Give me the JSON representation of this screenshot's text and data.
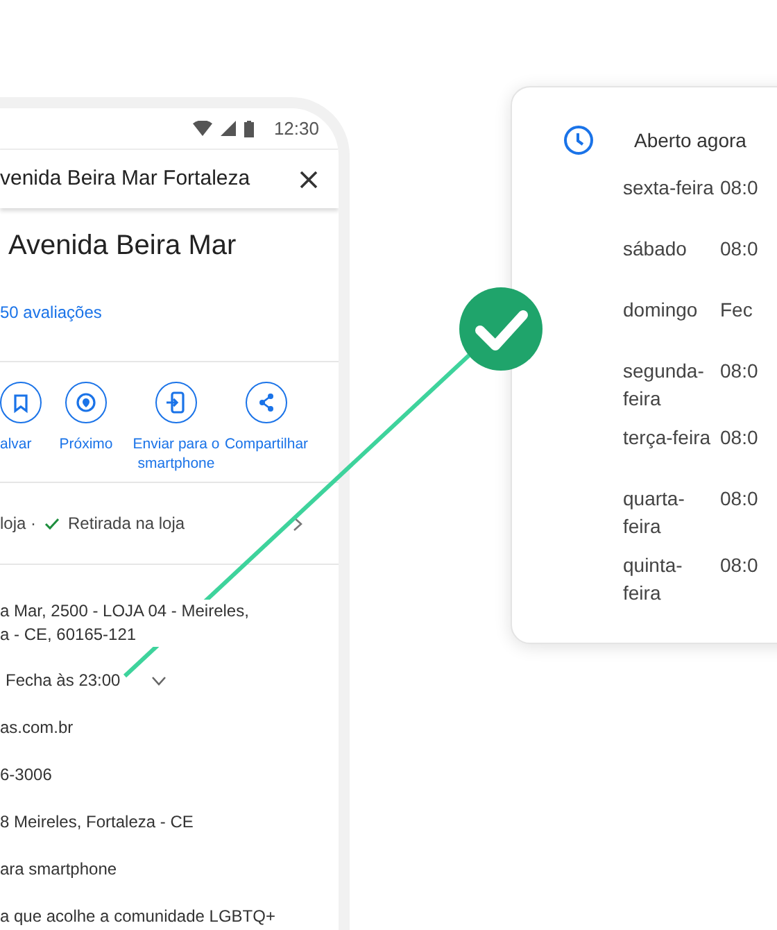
{
  "phone": {
    "status_bar": {
      "time": "12:30"
    },
    "search_bar": {
      "text": "venida Beira Mar Fortaleza"
    },
    "place": {
      "title": "Avenida Beira Mar",
      "reviews": "50 avaliações"
    },
    "actions": [
      {
        "kind": "bookmark",
        "label": "alvar"
      },
      {
        "kind": "nearby",
        "label": "Próximo"
      },
      {
        "kind": "send",
        "label": "Enviar para o smartphone"
      },
      {
        "kind": "share",
        "label": "Compartilhar"
      }
    ],
    "services": {
      "prefix": "loja ·",
      "label": "Retirada na loja"
    },
    "info_rows": [
      {
        "kind": "address",
        "lines": [
          "a Mar, 2500 - LOJA 04 - Meireles,",
          "a - CE, 60165-121"
        ]
      },
      {
        "kind": "hours",
        "lines": [
          "Fecha às 23:00"
        ],
        "expanded": false
      },
      {
        "kind": "plain",
        "lines": [
          "as.com.br"
        ]
      },
      {
        "kind": "plain",
        "lines": [
          "6-3006"
        ]
      },
      {
        "kind": "plain",
        "lines": [
          "8 Meireles, Fortaleza - CE"
        ]
      },
      {
        "kind": "plain",
        "lines": [
          "ara smartphone"
        ]
      },
      {
        "kind": "plain",
        "lines": [
          "a que acolhe a comunidade LGBTQ+"
        ]
      }
    ]
  },
  "hours_card": {
    "status": "Aberto agora",
    "days": [
      {
        "day": "sexta-feira",
        "hours": "08:0"
      },
      {
        "day": "sábado",
        "hours": "08:0"
      },
      {
        "day": "domingo",
        "hours": "Fec"
      },
      {
        "day": "segunda-feira",
        "hours": "08:0"
      },
      {
        "day": "terça-feira",
        "hours": "08:0"
      },
      {
        "day": "quarta-feira",
        "hours": "08:0"
      },
      {
        "day": "quinta-feira",
        "hours": "08:0"
      }
    ]
  }
}
